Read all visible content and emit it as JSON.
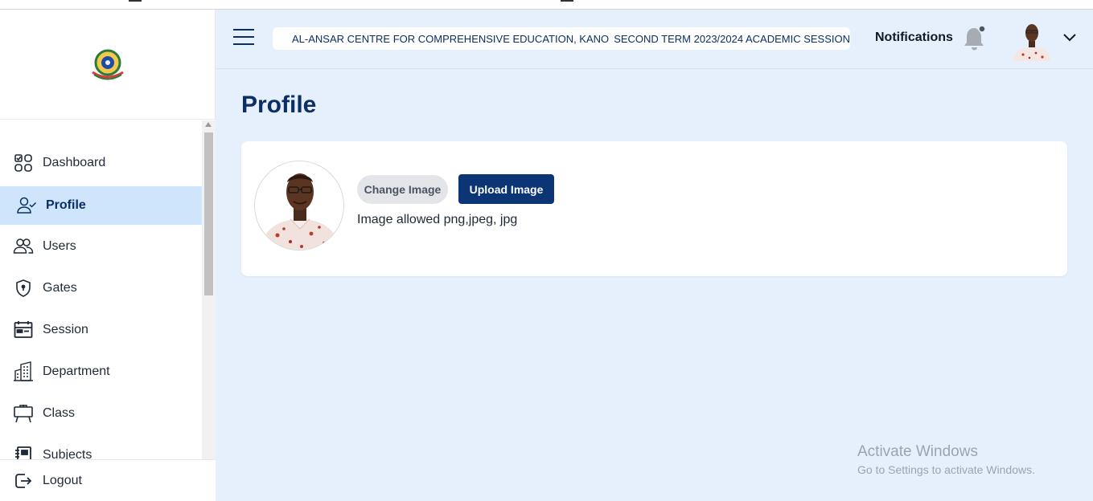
{
  "sidebar": {
    "items": [
      {
        "label": "Dashboard",
        "icon": "dashboard-icon"
      },
      {
        "label": "Profile",
        "icon": "user-check-icon",
        "active": true
      },
      {
        "label": "Users",
        "icon": "users-icon"
      },
      {
        "label": "Gates",
        "icon": "shield-icon"
      },
      {
        "label": "Session",
        "icon": "calendar-icon"
      },
      {
        "label": "Department",
        "icon": "building-icon"
      },
      {
        "label": "Class",
        "icon": "easel-icon"
      },
      {
        "label": "Subjects",
        "icon": "notebook-icon"
      }
    ],
    "logout_label": "Logout"
  },
  "header": {
    "school_name": "AL-ANSAR CENTRE FOR COMPREHENSIVE EDUCATION, KANO",
    "session_text": "SECOND TERM 2023/2024 ACADEMIC SESSION",
    "notifications_label": "Notifications"
  },
  "main": {
    "page_title": "Profile",
    "change_image_label": "Change Image",
    "upload_image_label": "Upload Image",
    "image_hint": "Image allowed png,jpeg, jpg"
  },
  "watermark": {
    "title": "Activate Windows",
    "subtitle": "Go to Settings to activate Windows."
  },
  "colors": {
    "accent": "#0b3574",
    "active_bg": "#cfe5fb",
    "page_bg": "#e6f0fc"
  }
}
